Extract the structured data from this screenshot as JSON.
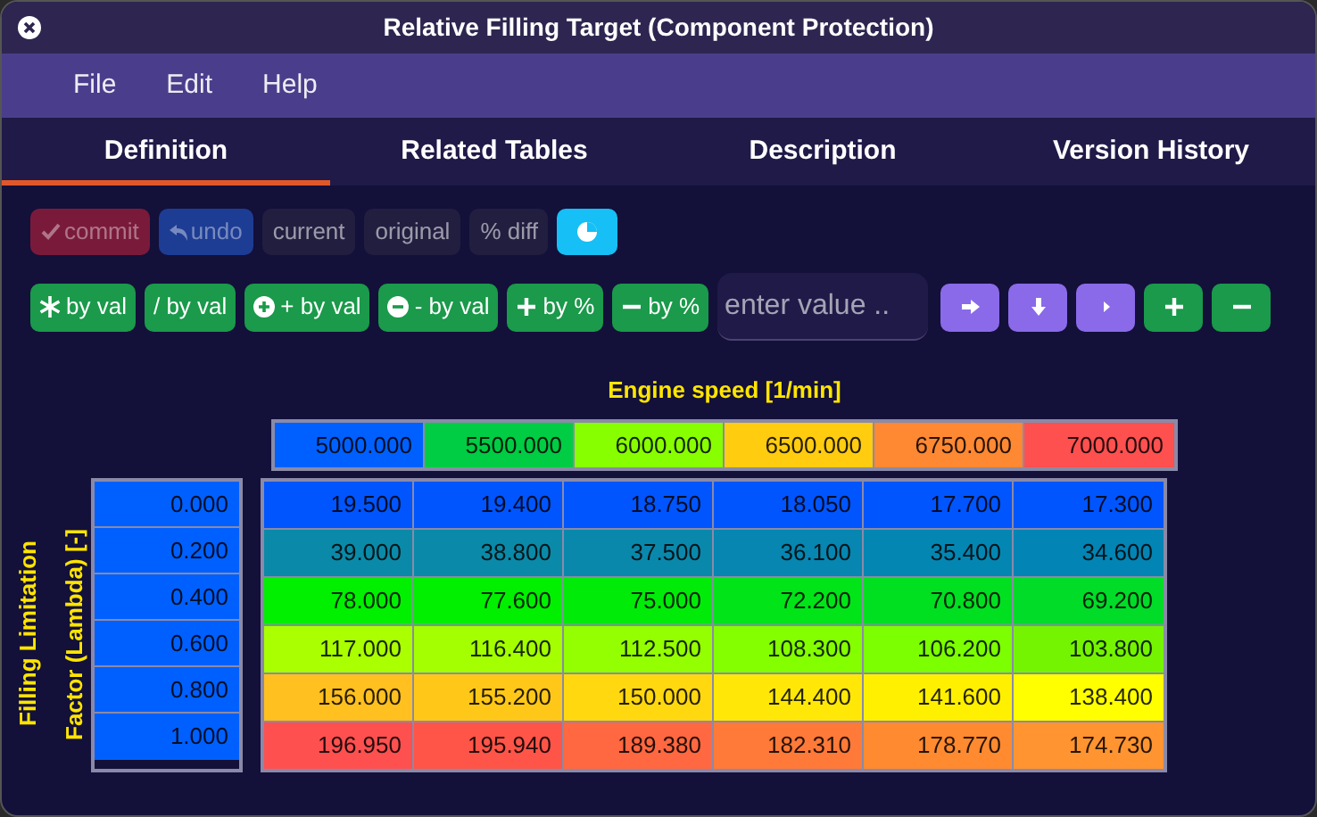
{
  "window": {
    "title": "Relative Filling Target (Component Protection)"
  },
  "menu": [
    "File",
    "Edit",
    "Help"
  ],
  "tabs": [
    {
      "label": "Definition",
      "selected": true
    },
    {
      "label": "Related Tables",
      "selected": false
    },
    {
      "label": "Description",
      "selected": false
    },
    {
      "label": "Version History",
      "selected": false
    }
  ],
  "toolbar": [
    {
      "kind": "commit",
      "label": "commit",
      "disabled": true
    },
    {
      "kind": "undo",
      "label": "undo",
      "disabled": true
    },
    {
      "kind": "view",
      "label": "current",
      "disabled": false
    },
    {
      "kind": "view",
      "label": "original",
      "disabled": false
    },
    {
      "kind": "view",
      "label": "% diff",
      "disabled": false
    },
    {
      "kind": "chart",
      "disabled": false
    }
  ],
  "operations": [
    {
      "kind": "multiply",
      "label": "by val"
    },
    {
      "kind": "divide",
      "label": "/ by val"
    },
    {
      "kind": "add",
      "label": "+ by val"
    },
    {
      "kind": "subtract",
      "label": "- by val"
    },
    {
      "kind": "increase",
      "label": "by %"
    },
    {
      "kind": "decrease",
      "label": "by %"
    }
  ],
  "value_input": {
    "placeholder": "enter value .."
  },
  "action_buttons": [
    {
      "kind": "right"
    },
    {
      "kind": "down"
    },
    {
      "kind": "step"
    },
    {
      "kind": "insert"
    },
    {
      "kind": "remove"
    }
  ],
  "table": {
    "x_axis_label": "Engine speed [1/min]",
    "y_axis_label": "Filling Limitation Factor (Lambda) [-]",
    "columns": [
      {
        "value": "5000.000",
        "color": "#0060ff"
      },
      {
        "value": "5500.000",
        "color": "#00cc44"
      },
      {
        "value": "6000.000",
        "color": "#88ff00"
      },
      {
        "value": "6500.000",
        "color": "#ffcc10"
      },
      {
        "value": "6750.000",
        "color": "#ff8833"
      },
      {
        "value": "7000.000",
        "color": "#ff5050"
      }
    ],
    "rows": [
      {
        "label": "0.000",
        "color": "#0060ff",
        "cells": [
          {
            "value": "19.500",
            "color": "#0055ff"
          },
          {
            "value": "19.400",
            "color": "#0055ff"
          },
          {
            "value": "18.750",
            "color": "#0055ff"
          },
          {
            "value": "18.050",
            "color": "#0055ff"
          },
          {
            "value": "17.700",
            "color": "#0055ff"
          },
          {
            "value": "17.300",
            "color": "#0055ff"
          }
        ]
      },
      {
        "label": "0.200",
        "color": "#0060ff",
        "cells": [
          {
            "value": "39.000",
            "color": "#0a8aa8"
          },
          {
            "value": "38.800",
            "color": "#0a8aa8"
          },
          {
            "value": "37.500",
            "color": "#0a88ac"
          },
          {
            "value": "36.100",
            "color": "#0686b0"
          },
          {
            "value": "35.400",
            "color": "#0486b2"
          },
          {
            "value": "34.600",
            "color": "#0284b4"
          }
        ]
      },
      {
        "label": "0.400",
        "color": "#0060ff",
        "cells": [
          {
            "value": "78.000",
            "color": "#00f000"
          },
          {
            "value": "77.600",
            "color": "#00f000"
          },
          {
            "value": "75.000",
            "color": "#00ec08"
          },
          {
            "value": "72.200",
            "color": "#00e418"
          },
          {
            "value": "70.800",
            "color": "#00e020"
          },
          {
            "value": "69.200",
            "color": "#00dc28"
          }
        ]
      },
      {
        "label": "0.600",
        "color": "#0060ff",
        "cells": [
          {
            "value": "117.000",
            "color": "#aaff00"
          },
          {
            "value": "116.400",
            "color": "#a4ff00"
          },
          {
            "value": "112.500",
            "color": "#94ff00"
          },
          {
            "value": "108.300",
            "color": "#84ff00"
          },
          {
            "value": "106.200",
            "color": "#7cff00"
          },
          {
            "value": "103.800",
            "color": "#74f400"
          }
        ]
      },
      {
        "label": "0.800",
        "color": "#0060ff",
        "cells": [
          {
            "value": "156.000",
            "color": "#ffc020"
          },
          {
            "value": "155.200",
            "color": "#ffc818"
          },
          {
            "value": "150.000",
            "color": "#ffd810"
          },
          {
            "value": "144.400",
            "color": "#ffe808"
          },
          {
            "value": "141.600",
            "color": "#fff000"
          },
          {
            "value": "138.400",
            "color": "#ffff00"
          }
        ]
      },
      {
        "label": "1.000",
        "color": "#0060ff",
        "cells": [
          {
            "value": "196.950",
            "color": "#ff5050"
          },
          {
            "value": "195.940",
            "color": "#ff5548"
          },
          {
            "value": "189.380",
            "color": "#ff6840"
          },
          {
            "value": "182.310",
            "color": "#ff7a38"
          },
          {
            "value": "178.770",
            "color": "#ff8a30"
          },
          {
            "value": "174.730",
            "color": "#ff9430"
          }
        ]
      }
    ]
  }
}
